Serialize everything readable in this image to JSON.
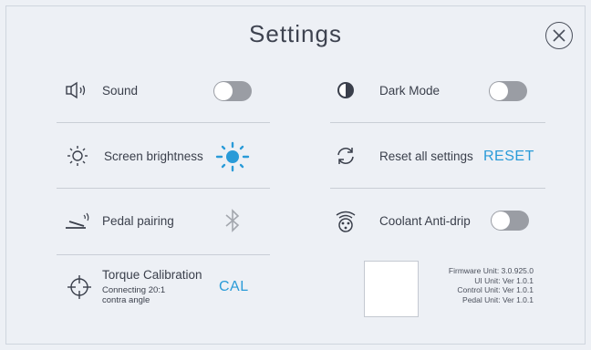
{
  "header": {
    "title": "Settings"
  },
  "settings": {
    "sound": {
      "label": "Sound",
      "toggle": "off"
    },
    "dark_mode": {
      "label": "Dark Mode",
      "toggle": "off"
    },
    "screen_brightness": {
      "label": "Screen brightness"
    },
    "reset": {
      "label": "Reset all settings",
      "action": "RESET"
    },
    "pedal_pairing": {
      "label": "Pedal pairing"
    },
    "coolant": {
      "label": "Coolant Anti-drip",
      "toggle": "off"
    },
    "torque": {
      "label": "Torque Calibration",
      "sub1": "Connecting 20:1",
      "sub2": "contra angle",
      "action": "CAL"
    }
  },
  "versions": [
    "Firmware Unit: 3.0.925.0",
    "UI Unit: Ver 1.0.1",
    "Control Unit: Ver 1.0.1",
    "Pedal Unit: Ver 1.0.1"
  ],
  "colors": {
    "accent": "#2a9bd8",
    "toggle_off": "#9a9da4",
    "background": "#edf0f5"
  },
  "icons": {
    "sound": "speaker-icon",
    "dark_mode": "contrast-icon",
    "brightness": "sun-icon",
    "reset": "refresh-icon",
    "pedal": "pedal-icon",
    "bluetooth": "bluetooth-icon",
    "coolant": "coolant-icon",
    "torque": "crosshair-icon",
    "close": "close-icon"
  }
}
